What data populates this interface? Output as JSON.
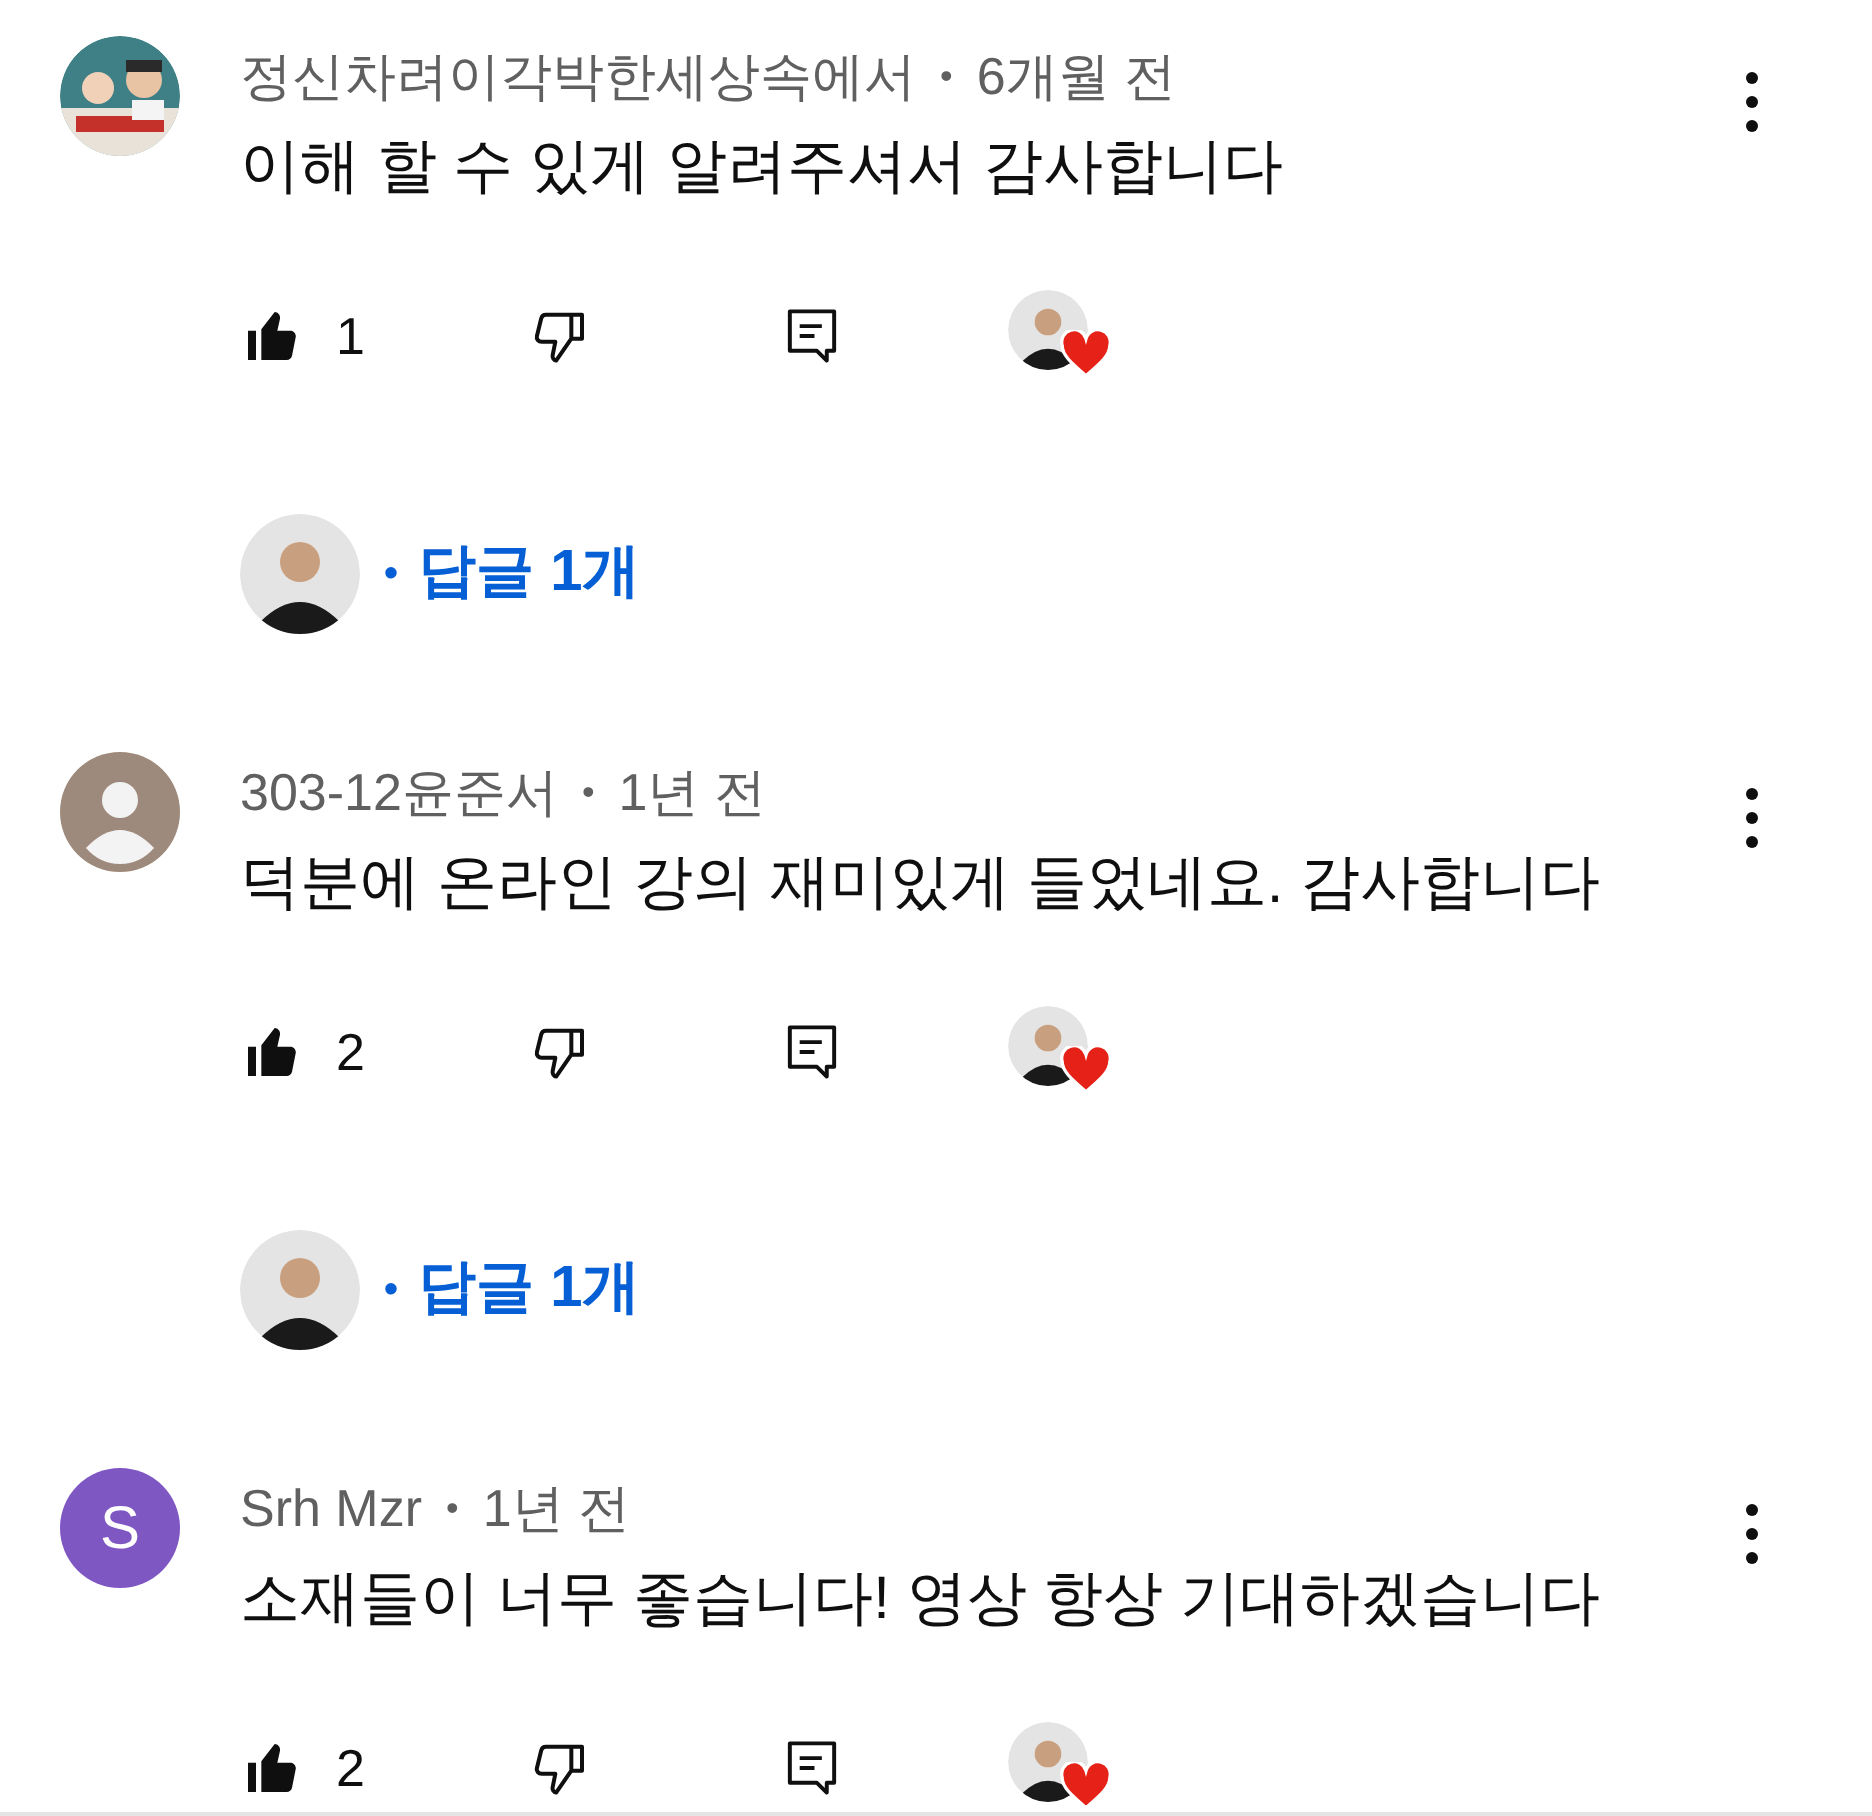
{
  "comments": [
    {
      "author": "정신차려이각박한세상속에서",
      "separator": "•",
      "time": "6개월 전",
      "text": "이해 할 수 있게 알려주셔서 감사합니다",
      "liked": true,
      "likes": "1",
      "hearted": true,
      "replies": {
        "bullet": "•",
        "label": "답글 1개"
      }
    },
    {
      "avatar": {
        "kind": "default"
      },
      "author": "303-12윤준서",
      "separator": "•",
      "time": "1년 전",
      "text": "덕분에 온라인 강의 재미있게 들었네요. 감사합니다",
      "liked": true,
      "likes": "2",
      "hearted": true,
      "replies": {
        "bullet": "•",
        "label": "답글 1개"
      }
    },
    {
      "avatar": {
        "kind": "letter",
        "letter": "S",
        "color": "#7e57c2"
      },
      "author": "Srh Mzr",
      "separator": "•",
      "time": "1년 전",
      "text": "소재들이 너무 좋습니다! 영상 항상 기대하겠습니다",
      "liked": true,
      "likes": "2",
      "hearted": true
    }
  ]
}
